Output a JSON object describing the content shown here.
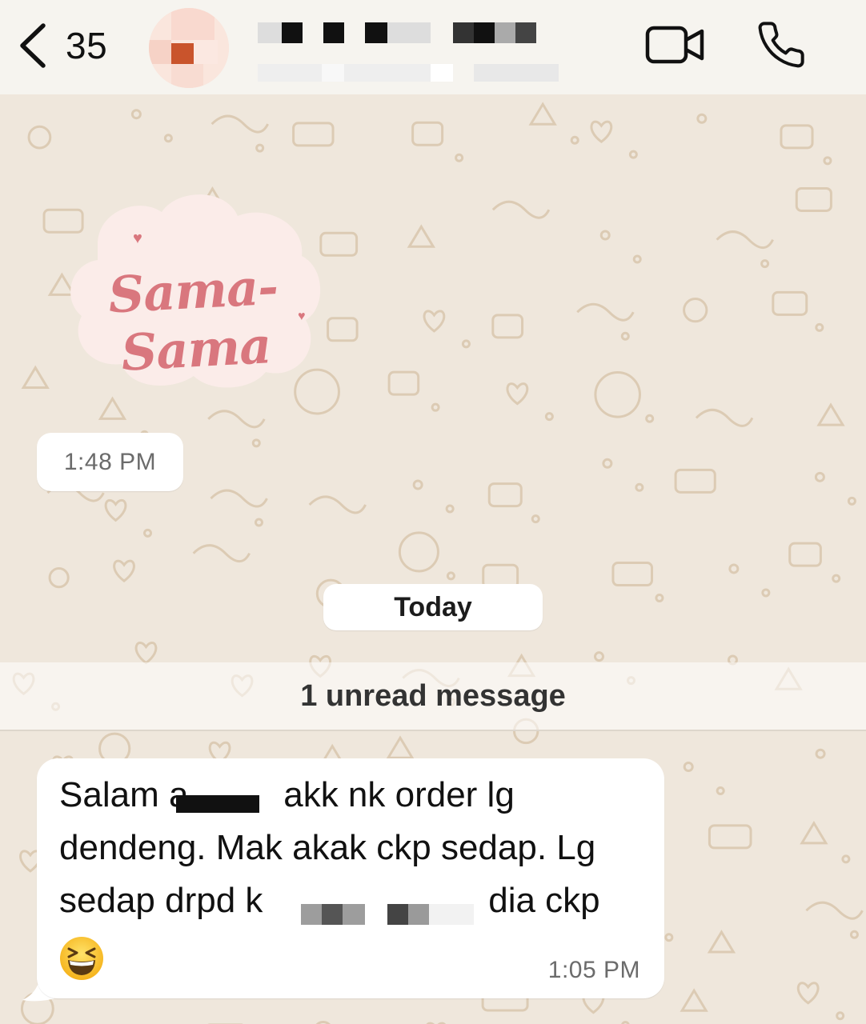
{
  "header": {
    "back_count": "35",
    "contact_name": "",
    "icons": [
      "chevron-left-icon",
      "video-camera-icon",
      "phone-icon"
    ]
  },
  "sticker": {
    "text": "Sama-Sama"
  },
  "messages": [
    {
      "type": "sticker",
      "time": "1:48 PM"
    },
    {
      "type": "date-divider",
      "label": "Today"
    },
    {
      "type": "unread-divider",
      "label": "1 unread message"
    },
    {
      "type": "text",
      "lines": [
        "Salam a",
        " akk nk order lg",
        "dendeng. Mak akak ckp sedap. Lg",
        "sedap drpd k",
        " dia ckp"
      ],
      "emoji": "grinning-squinting-face",
      "time": "1:05 PM"
    }
  ],
  "colors": {
    "wallpaper": "#efe7dc",
    "header": "#f6f4ef",
    "bubble": "#ffffff",
    "sticker_text": "#d9777e",
    "doodle_stroke": "#dccbb4"
  }
}
